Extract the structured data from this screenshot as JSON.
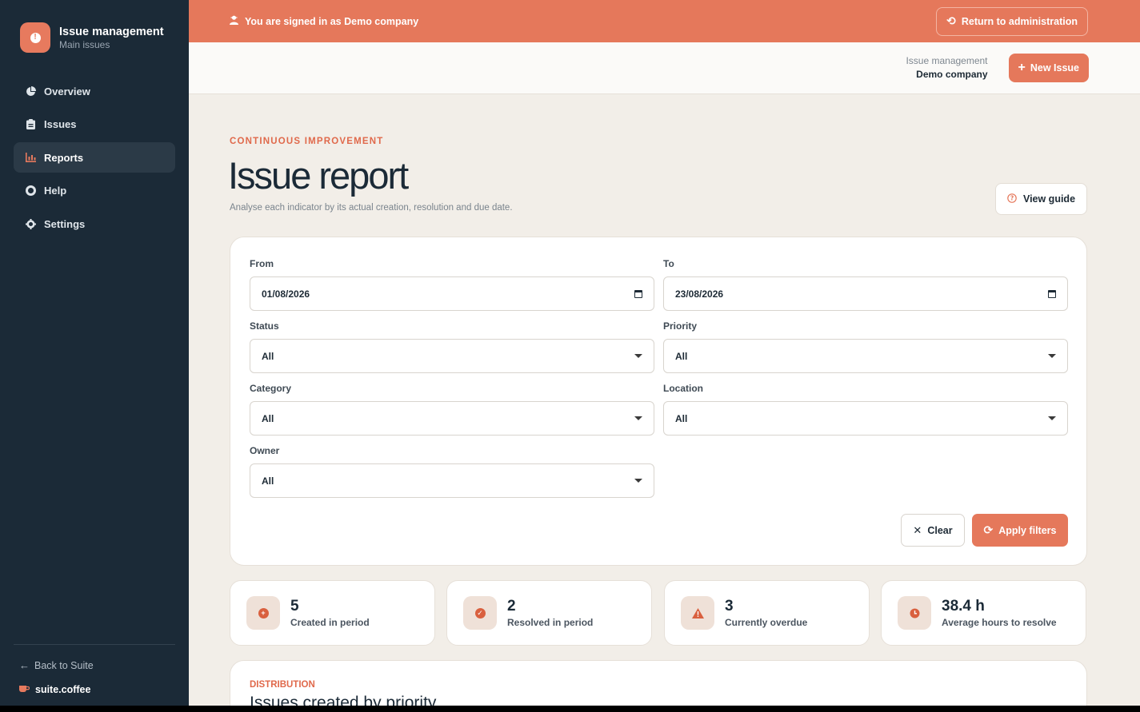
{
  "brand": {
    "title": "Issue management",
    "subtitle": "Main issues"
  },
  "sidebar": {
    "items": [
      {
        "label": "Overview",
        "icon": "pie-chart-icon",
        "active": false
      },
      {
        "label": "Issues",
        "icon": "clipboard-icon",
        "active": false
      },
      {
        "label": "Reports",
        "icon": "bar-chart-icon",
        "active": true
      },
      {
        "label": "Help",
        "icon": "lifebuoy-icon",
        "active": false
      },
      {
        "label": "Settings",
        "icon": "gear-icon",
        "active": false
      }
    ],
    "back_label": "Back to Suite",
    "suite_label": "suite.coffee"
  },
  "banner": {
    "text": "You are signed in as Demo company",
    "return_label": "Return to administration"
  },
  "topbar": {
    "company_label": "Issue management",
    "company_name": "Demo company",
    "new_issue_label": "New Issue"
  },
  "header": {
    "eyebrow": "CONTINUOUS IMPROVEMENT",
    "title": "Issue report",
    "subtitle": "Analyse each indicator by its actual creation, resolution and due date.",
    "guide_label": "View guide"
  },
  "filters": {
    "from": {
      "label": "From",
      "value": "01/08/2026"
    },
    "to": {
      "label": "To",
      "value": "23/08/2026"
    },
    "status": {
      "label": "Status",
      "value": "All"
    },
    "priority": {
      "label": "Priority",
      "value": "All"
    },
    "category": {
      "label": "Category",
      "value": "All"
    },
    "location": {
      "label": "Location",
      "value": "All"
    },
    "owner": {
      "label": "Owner",
      "value": "All"
    },
    "clear_label": "Clear",
    "apply_label": "Apply filters"
  },
  "stats": [
    {
      "value": "5",
      "label": "Created in period",
      "icon": "plus-circle-icon"
    },
    {
      "value": "2",
      "label": "Resolved in period",
      "icon": "check-circle-icon"
    },
    {
      "value": "3",
      "label": "Currently overdue",
      "icon": "warning-icon"
    },
    {
      "value": "38.4 h",
      "label": "Average hours to resolve",
      "icon": "clock-icon"
    }
  ],
  "distribution": {
    "eyebrow": "DISTRIBUTION",
    "title": "Issues created by priority"
  },
  "colors": {
    "accent": "#e5785b",
    "sidebar": "#1b2a37",
    "page": "#f2eee8"
  }
}
